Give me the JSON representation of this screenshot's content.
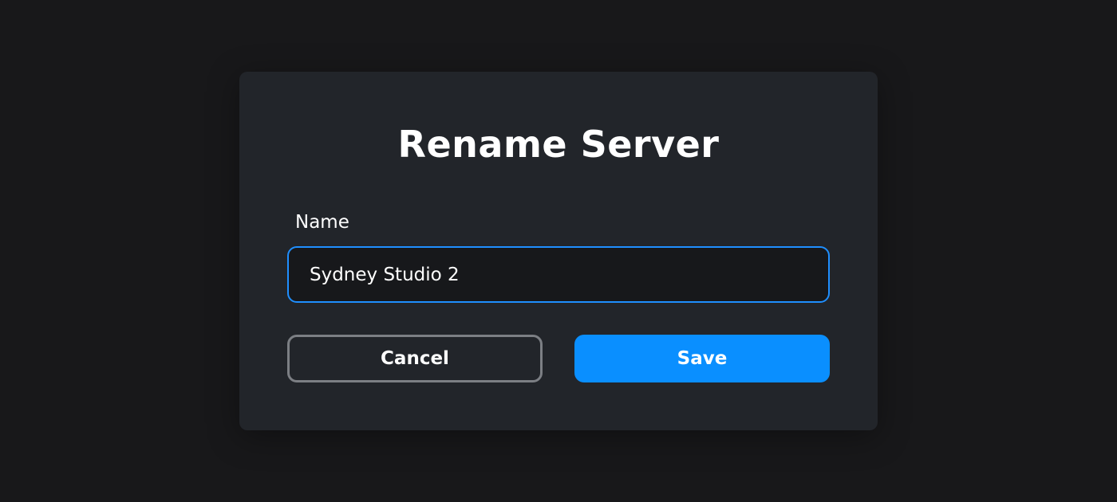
{
  "dialog": {
    "title": "Rename Server",
    "name_label": "Name",
    "name_value": "Sydney Studio 2",
    "cancel_label": "Cancel",
    "save_label": "Save"
  },
  "colors": {
    "accent": "#0a8fff",
    "input_border": "#1f8fff",
    "dialog_background": "#22252a",
    "page_background": "#18181a"
  }
}
